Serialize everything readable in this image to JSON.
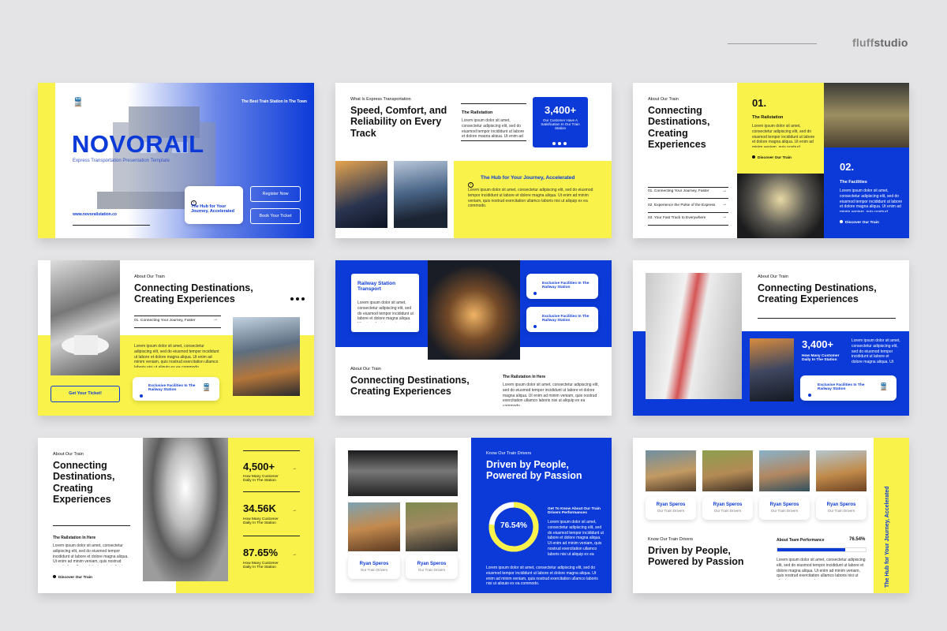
{
  "brand": {
    "name_prefix": "fluff",
    "name_suffix": "studio"
  },
  "colors": {
    "yellow": "#f8f24a",
    "blue": "#0b3ad8"
  },
  "lorem": "Lorem ipsum dolor sit amet, consectetur adipiscing elit, sed do eiusmod tempor incididunt ut labore et dolore magna aliqua. Ut enim ad minim veniam, quis nostrud exercitation ullamco laboris nisi ut aliquip ex ea commodo.",
  "s1": {
    "tag": "The Best Train Station In The Town",
    "title": "NOVORAIL",
    "subtitle": "Express Transportation Presentation Template",
    "card": "The Hub for Your Journey, Accelerated",
    "btn1": "Register Now",
    "btn2": "Book Your Ticket",
    "url": "www.novorailstation.co"
  },
  "s2": {
    "pre": "What Is Express Transportation",
    "title": "Speed, Comfort, and Reliability on Every Track",
    "sub": "The Railstation",
    "stat": "3,400+",
    "stat_lbl": "Our Customer Have A Satisfication In Our Train Station",
    "banner": "The Hub for Your Journey, Accelerated"
  },
  "s3": {
    "pre": "About Our Train",
    "title": "Connecting Destinations, Creating Experiences",
    "n1": "01.",
    "n1_lbl": "The Railstation",
    "n1_link": "Discover Our Train",
    "n2": "02.",
    "n2_lbl": "The Facilities",
    "n2_link": "Discover Our Train",
    "i1": "01. Connecting Your Journey, Faster",
    "i2": "02. Experience the Pulse of the Express",
    "i3": "03. Your Fast Track to Everywhere"
  },
  "s4": {
    "pre": "About Our Train",
    "title": "Connecting Destinations, Creating Experiences",
    "i1": "01. Connecting Your Journey, Faster",
    "btn": "Get Your Ticket!",
    "card": "Exclusive Facilities In The Railway Station"
  },
  "s5": {
    "box": "Railway Station Transport",
    "c1": "Exclusive Facilities In The Railway Station",
    "c2": "Exclusive Facilities In The Railway Station",
    "pre": "About Our Train",
    "title": "Connecting Destinations, Creating Experiences",
    "sub": "The Railstation In Here"
  },
  "s6": {
    "pre": "About Our Train",
    "title": "Connecting Destinations, Creating Experiences",
    "stat": "3,400+",
    "stat_lbl": "How Many Customer Daily In The Station",
    "card": "Exclusive Facilities In The Railway Station"
  },
  "s7": {
    "pre": "About Our Train",
    "title": "Connecting Destinations, Creating Experiences",
    "sub": "The Railstation In Here",
    "link": "Discover Our Train",
    "st1": "4,500+",
    "st1_lbl": "How Many Customer Daily In The Station",
    "st2": "34.56K",
    "st2_lbl": "How Many Customer Daily In The Station",
    "st3": "87.65%",
    "st3_lbl": "How Many Customer Daily In The Station"
  },
  "s8": {
    "pre": "Know Our Train Drivers",
    "title": "Driven by People, Powered by Passion",
    "pct": "76.54%",
    "pct_value": 76.54,
    "pct_lbl": "Get To Know About Our Train Drivers Performances",
    "n1": "Ryan Speros",
    "r1": "Our Train Drivers",
    "n2": "Ryan Speros",
    "r2": "Our Train Drivers"
  },
  "s9": {
    "drivers": [
      {
        "name": "Ryan Speros",
        "role": "Our Train Drivers"
      },
      {
        "name": "Ryan Speros",
        "role": "Our Train Drivers"
      },
      {
        "name": "Ryan Speros",
        "role": "Our Train Drivers"
      },
      {
        "name": "Ryan Speros",
        "role": "Our Train Drivers"
      }
    ],
    "pre": "Know Our Train Drivers",
    "title": "Driven by People, Powered by Passion",
    "perf_lbl": "About Team Performance",
    "perf": "76.54%",
    "perf_value": 76.54,
    "side": "The Hub for Your Journey, Accelerated"
  }
}
